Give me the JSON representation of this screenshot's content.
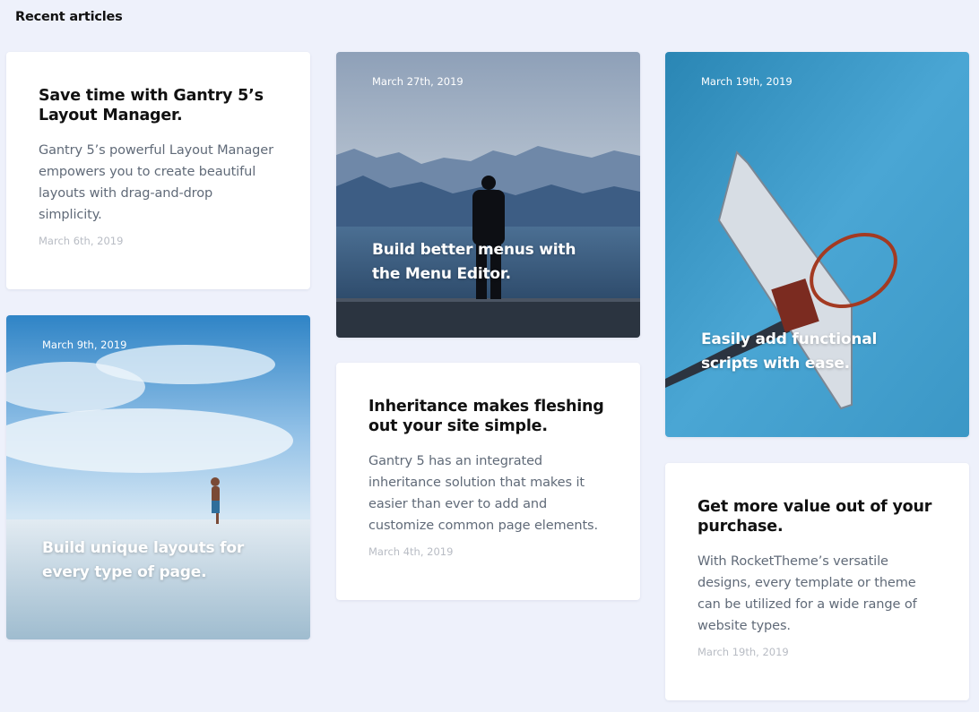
{
  "section": {
    "title": "Recent articles"
  },
  "articles": [
    {
      "kind": "text",
      "title": "Save time with Gantry 5’s Layout Manager.",
      "excerpt": "Gantry 5’s powerful Layout Manager empowers you to create beautiful layouts with drag-and-drop simplicity.",
      "date": "March 6th, 2019"
    },
    {
      "kind": "image",
      "image": "person-standing-on-pier-mountains-lake",
      "title": "Build better menus with the Menu Editor.",
      "date": "March 27th, 2019"
    },
    {
      "kind": "image",
      "image": "basketball-hoop-blue-sky",
      "title": "Easily add functional scripts with ease.",
      "date": "March 19th, 2019"
    },
    {
      "kind": "image",
      "image": "person-dancing-on-salt-flat-sky-reflection",
      "title": "Build unique layouts for every type of page.",
      "date": "March 9th, 2019"
    },
    {
      "kind": "text",
      "title": "Inheritance makes fleshing out your site simple.",
      "excerpt": "Gantry 5 has an integrated inheritance solution that makes it easier than ever to add and customize common page elements.",
      "date": "March 4th, 2019"
    },
    {
      "kind": "text",
      "title": "Get more value out of your purchase.",
      "excerpt": "With RocketTheme’s versatile designs, every template or theme can be utilized for a wide range of website types.",
      "date": "March 19th, 2019"
    }
  ],
  "colors": {
    "page_background": "#eef1fb",
    "card_background": "#ffffff",
    "title_text": "#111111",
    "excerpt_text": "#606a78",
    "date_text": "#b8bcc4"
  }
}
